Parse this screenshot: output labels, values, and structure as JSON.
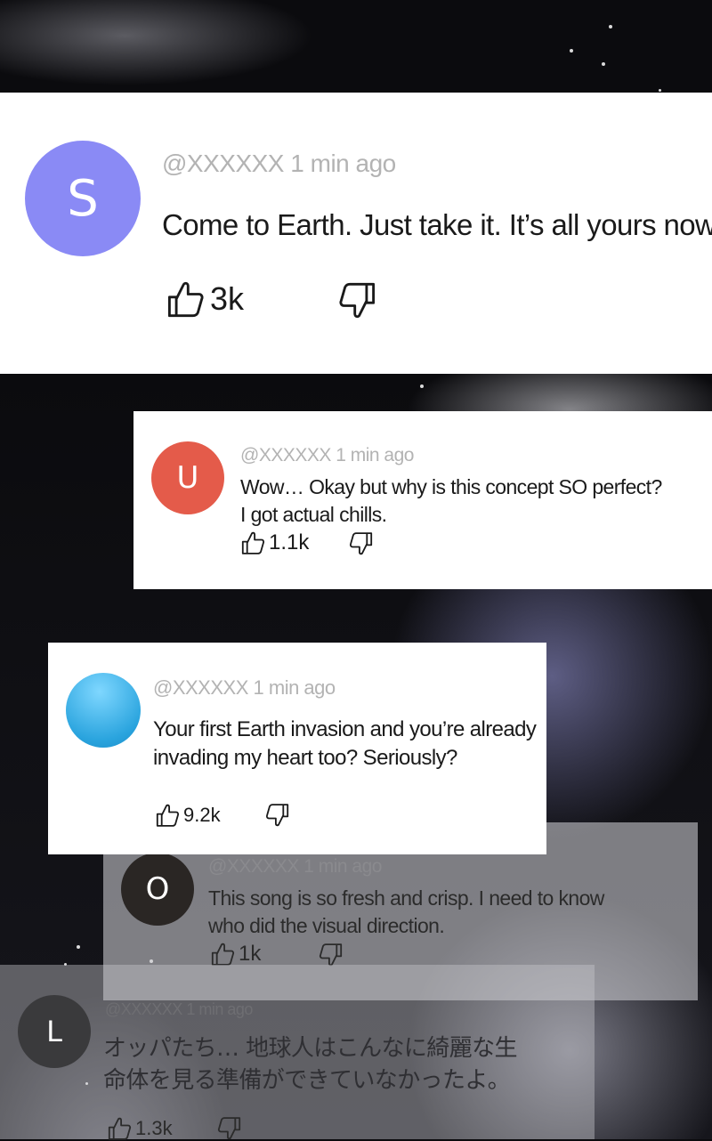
{
  "comments": [
    {
      "initial": "S",
      "avatar_color": "#8a8af5",
      "username": "@XXXXXX",
      "time": "1 min ago",
      "text": "Come to Earth. Just take it. It’s all yours now.",
      "likes": "3k",
      "like_icon": "thumbs-up-icon",
      "dislike_icon": "thumbs-down-icon"
    },
    {
      "initial": "U",
      "avatar_color": "#e45b4a",
      "username": "@XXXXXX",
      "time": "1 min ago",
      "text_line1": "Wow… Okay but why is this concept SO perfect?",
      "text_line2": "I got actual chills.",
      "likes": "1.1k",
      "like_icon": "thumbs-up-icon",
      "dislike_icon": "thumbs-down-icon"
    },
    {
      "initial": "",
      "avatar_color": "#3fb3e6",
      "username": "@XXXXXX",
      "time": "1 min ago",
      "text_line1": "Your first Earth invasion and you’re already",
      "text_line2": "invading my heart too? Seriously?",
      "likes": "9.2k",
      "like_icon": "thumbs-up-icon",
      "dislike_icon": "thumbs-down-icon"
    },
    {
      "initial": "O",
      "avatar_color": "#2a2624",
      "username": "@XXXXXX",
      "time": "1 min ago",
      "text_line1": "This song is so fresh and crisp. I need to know",
      "text_line2": "who did the visual direction.",
      "likes": "1k",
      "like_icon": "thumbs-up-icon",
      "dislike_icon": "thumbs-down-icon"
    },
    {
      "initial": "L",
      "avatar_color": "#3a3a3c",
      "username": "@XXXXXX",
      "time": "1 min ago",
      "text_line1": "オッパたち… 地球人はこんなに綺麗な生",
      "text_line2": "命体を見る準備ができていなかったよ。",
      "likes": "1.3k",
      "like_icon": "thumbs-up-icon",
      "dislike_icon": "thumbs-down-icon"
    }
  ]
}
